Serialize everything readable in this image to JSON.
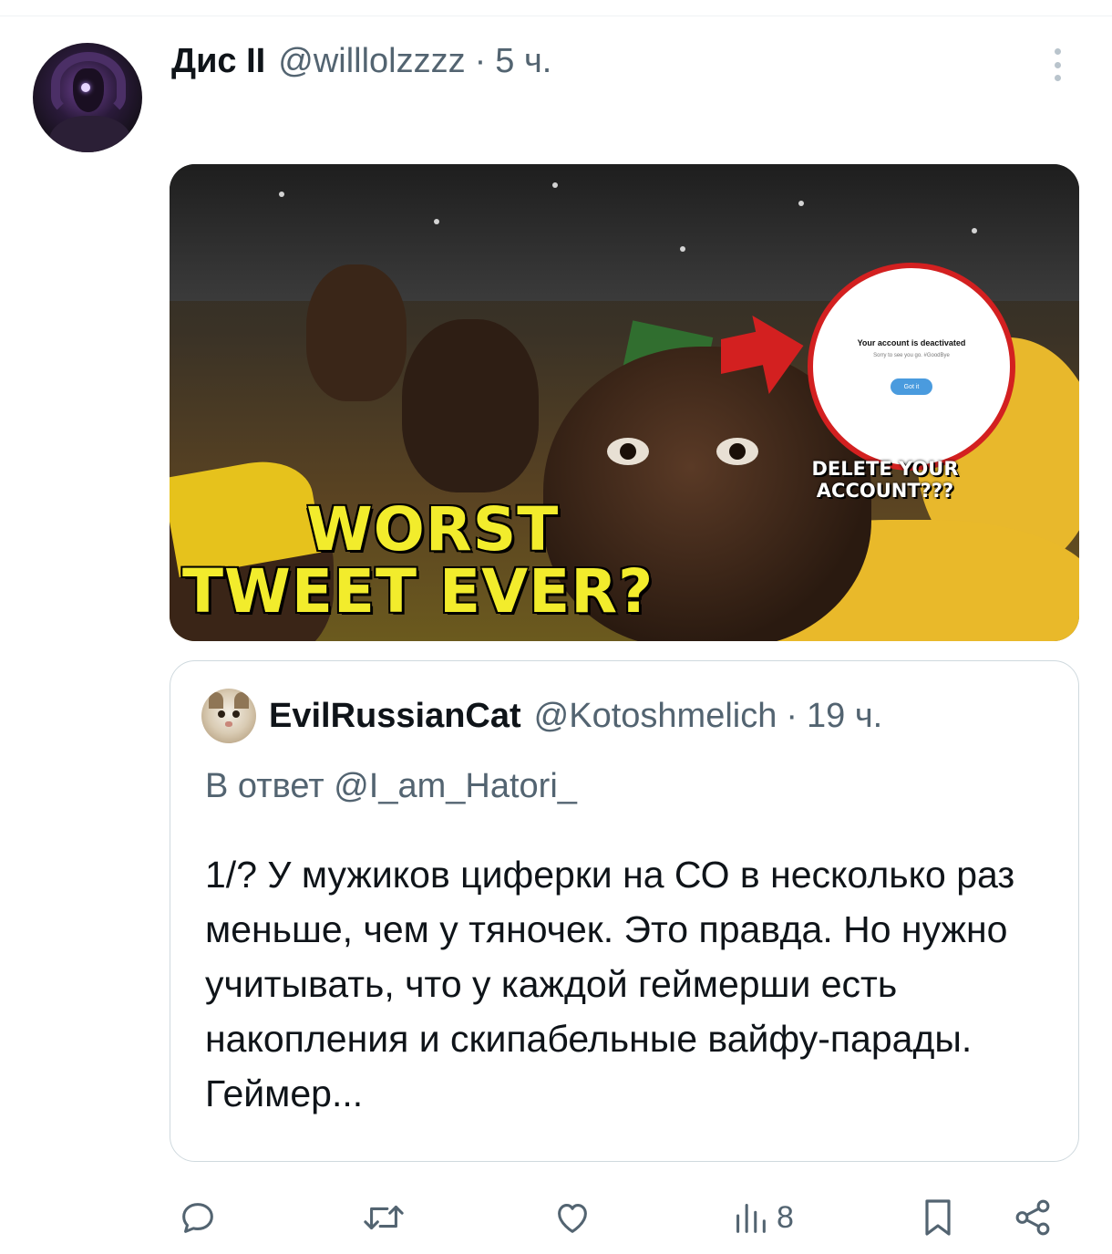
{
  "post": {
    "author_name": "Дис II",
    "author_handle": "@willlolzzzz",
    "separator": "·",
    "time": "5 ч."
  },
  "media": {
    "overlay_title": "Your account is deactivated",
    "overlay_subtitle": "Sorry to see you go. #GoodBye",
    "overlay_button": "Got it",
    "caption_small": "DELETE YOUR ACCOUNT???",
    "caption_line1": "WORST",
    "caption_line2": "TWEET EVER?"
  },
  "quote": {
    "author_name": "EvilRussianCat",
    "author_handle": "@Kotoshmelich",
    "separator": "·",
    "time": "19 ч.",
    "reply_prefix": "В ответ",
    "reply_mention": "@I_am_Hatori_",
    "text": "1/? У мужиков циферки на СО в несколько раз меньше, чем у тяночек. Это правда. Но нужно учитывать, что у каждой геймерши есть накопления и скипабельные вайфу-парады. Геймер..."
  },
  "actions": {
    "views_count": "8",
    "icons": [
      "reply-icon",
      "retweet-icon",
      "like-icon",
      "views-icon",
      "bookmark-icon",
      "share-icon"
    ]
  },
  "colors": {
    "text_primary": "#0f1419",
    "text_secondary": "#536471",
    "border": "#cfd9de",
    "caption_yellow": "#f2ec2c",
    "overlay_red": "#d32020"
  }
}
